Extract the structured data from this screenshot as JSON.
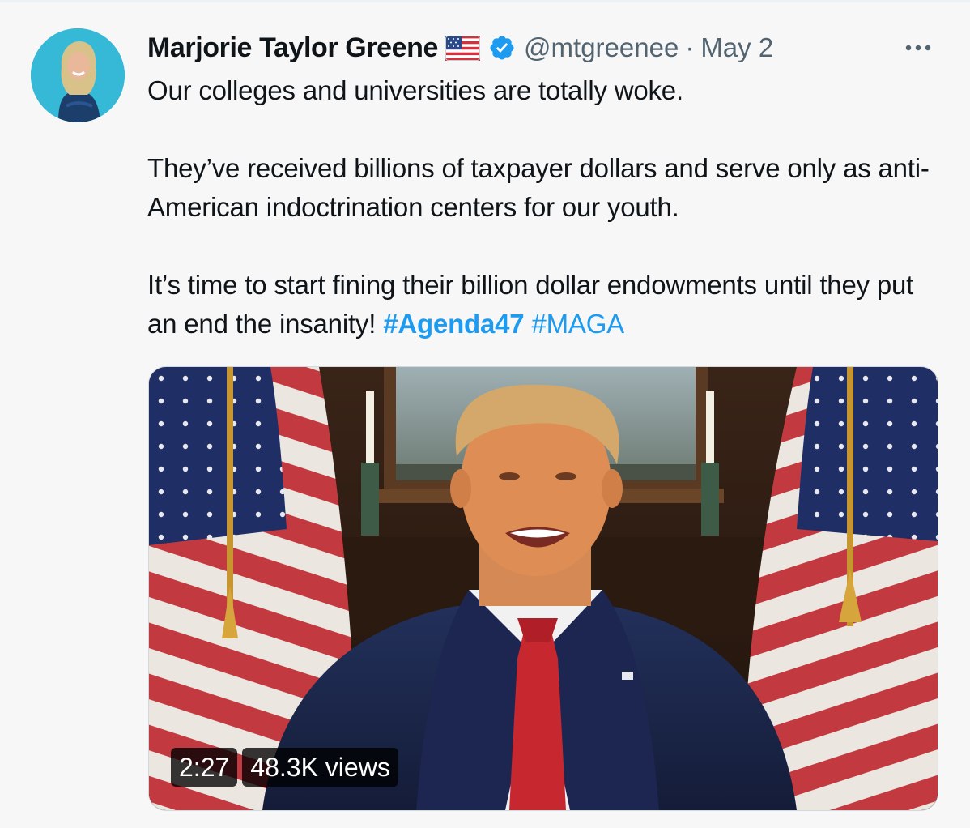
{
  "author": {
    "name": "Marjorie Taylor Greene",
    "handle": "@mtgreenee",
    "separator": "·",
    "date": "May 2"
  },
  "tweet": {
    "paragraph1": "Our colleges and universities are totally woke.",
    "paragraph2": "They’ve received billions of taxpayer dollars and serve only as anti-American indoctrination centers for our youth.",
    "paragraph3_text": "It’s time to start fining their billion dollar endowments until they put an end the insanity!",
    "hashtags": [
      "#Agenda47",
      "#MAGA"
    ]
  },
  "video": {
    "duration": "2:27",
    "views": "48.3K views"
  },
  "icons": {
    "flag": "us-flag-icon",
    "verified": "verified-badge-icon",
    "more": "more-options-icon"
  },
  "colors": {
    "background": "#f7f7f7",
    "link": "#1d9bf0",
    "secondary_text": "#536471",
    "verified": "#1d9bf0"
  }
}
